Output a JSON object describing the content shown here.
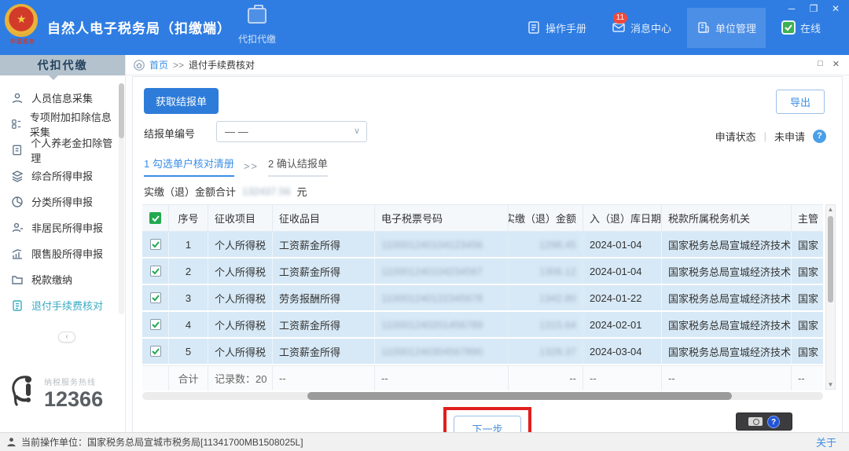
{
  "app": {
    "title": "自然人电子税务局（扣缴端）",
    "brand_caption": "中国税务"
  },
  "window_controls": {
    "minimize": "─",
    "restore": "❐",
    "close": "✕"
  },
  "header": {
    "nav_tab": {
      "label": "代扣代缴"
    },
    "manual_label": "操作手册",
    "messages_label": "消息中心",
    "messages_badge": "11",
    "org_label": "单位管理",
    "online_label": "在线"
  },
  "inner_controls": {
    "maximize": "□",
    "close": "✕"
  },
  "sidebar": {
    "title": "代扣代缴",
    "items": [
      {
        "label": "人员信息采集"
      },
      {
        "label": "专项附加扣除信息采集"
      },
      {
        "label": "个人养老金扣除管理"
      },
      {
        "label": "综合所得申报"
      },
      {
        "label": "分类所得申报"
      },
      {
        "label": "非居民所得申报"
      },
      {
        "label": "限售股所得申报"
      },
      {
        "label": "税款缴纳"
      },
      {
        "label": "退付手续费核对"
      }
    ],
    "collapse_glyph": "‹",
    "hotline_label": "纳税服务热线",
    "hotline_number": "12366"
  },
  "breadcrumb": {
    "home": "首页",
    "separator": ">>",
    "current": "退付手续费核对"
  },
  "actions": {
    "fetch_report": "获取结报单",
    "export": "导出",
    "next": "下一步"
  },
  "filter": {
    "report_no_label": "结报单编号",
    "report_no_value": "— —",
    "status_label": "申请状态",
    "status_divider": "|",
    "status_value": "未申请",
    "help_glyph": "?"
  },
  "steps": {
    "step1": "1 勾选单户核对清册",
    "separator": ">>",
    "step2": "2 确认结报单"
  },
  "summary": {
    "label": "实缴（退）金额合计",
    "amount_masked": "132437.56",
    "unit": "元"
  },
  "table": {
    "headers": {
      "no": "序号",
      "item": "征收项目",
      "sub": "征收品目",
      "ticket": "电子税票号码",
      "amount": "实缴（退）金额",
      "date": "入（退）库日期",
      "authority": "税款所属税务机关",
      "main": "主管"
    },
    "rows": [
      {
        "no": "1",
        "item": "个人所得税",
        "sub": "工资薪金所得",
        "ticket_masked": "110001240104123456",
        "amount_masked": "1298.45",
        "date": "2024-01-04",
        "authority": "国家税务总局宣城经济技术...",
        "main": "国家"
      },
      {
        "no": "2",
        "item": "个人所得税",
        "sub": "工资薪金所得",
        "ticket_masked": "110001240104234567",
        "amount_masked": "1306.12",
        "date": "2024-01-04",
        "authority": "国家税务总局宣城经济技术...",
        "main": "国家"
      },
      {
        "no": "3",
        "item": "个人所得税",
        "sub": "劳务报酬所得",
        "ticket_masked": "110001240122345678",
        "amount_masked": "1342.80",
        "date": "2024-01-22",
        "authority": "国家税务总局宣城经济技术...",
        "main": "国家"
      },
      {
        "no": "4",
        "item": "个人所得税",
        "sub": "工资薪金所得",
        "ticket_masked": "110001240201456789",
        "amount_masked": "1315.64",
        "date": "2024-02-01",
        "authority": "国家税务总局宣城经济技术...",
        "main": "国家"
      },
      {
        "no": "5",
        "item": "个人所得税",
        "sub": "工资薪金所得",
        "ticket_masked": "110001240304567890",
        "amount_masked": "1328.37",
        "date": "2024-03-04",
        "authority": "国家税务总局宣城经济技术...",
        "main": "国家"
      }
    ],
    "footer": {
      "label": "合计",
      "count": "记录数：20",
      "dash": "--"
    }
  },
  "statusbar": {
    "operator": "当前操作单位：国家税务总局宣城市税务局[11341700MB1508025L]",
    "about": "关于"
  },
  "colors": {
    "header_blue": "#2f7de2",
    "accent_blue": "#3a8ee6",
    "active_teal": "#3aabc4",
    "row_selected": "#d7e9f6",
    "annotation_red": "#e01f1f",
    "badge_red": "#f0493c",
    "check_green": "#21a94f"
  }
}
